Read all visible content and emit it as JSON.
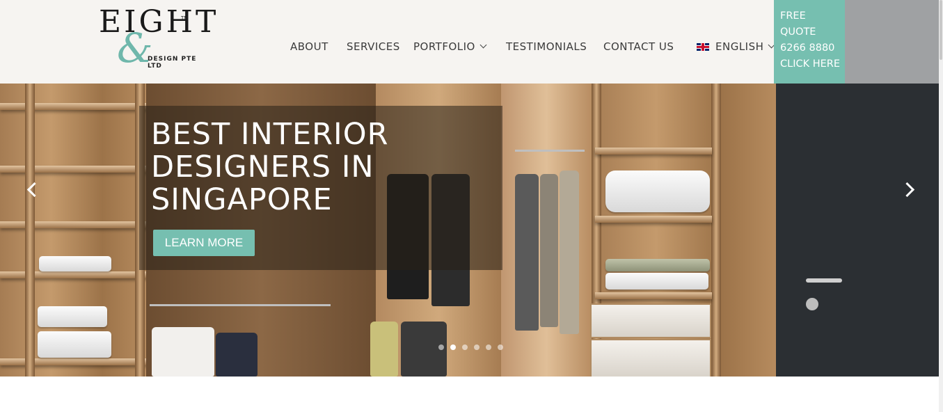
{
  "logo": {
    "word": "EIGHT",
    "ampersand": "&",
    "tagline": "DESIGN PTE LTD",
    "trademark": "TM"
  },
  "nav": {
    "items": [
      {
        "label": "ABOUT"
      },
      {
        "label": "SERVICES"
      },
      {
        "label": "PORTFOLIO"
      },
      {
        "label": "TESTIMONIALS"
      },
      {
        "label": "CONTACT US"
      },
      {
        "label": "ENGLISH"
      }
    ]
  },
  "quote": {
    "line1": "FREE",
    "line2": "QUOTE",
    "line3": "6266 8880",
    "line4": "CLICK HERE"
  },
  "hero": {
    "headline_l1": "BEST INTERIOR",
    "headline_l2": "DESIGNERS IN",
    "headline_l3": "SINGAPORE",
    "button": "LEARN MORE",
    "slide_count": 6,
    "active_slide": 2
  },
  "colors": {
    "accent": "#76bfb0",
    "nav_text": "#3a3a3a"
  }
}
